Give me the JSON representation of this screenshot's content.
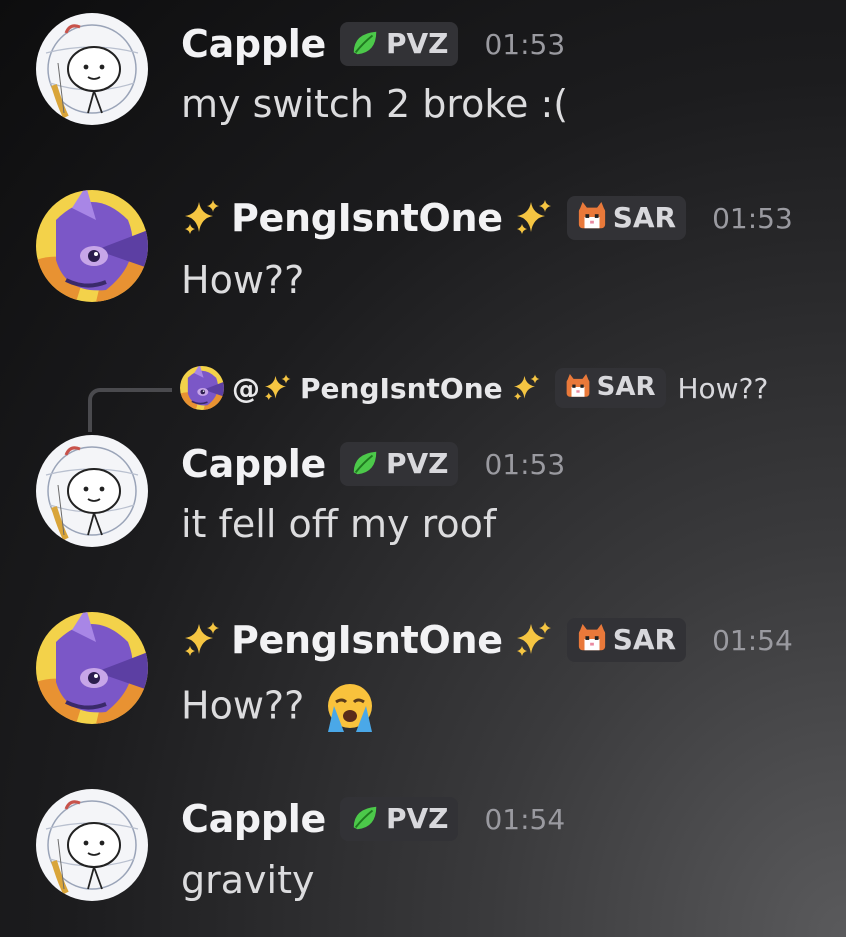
{
  "messages": [
    {
      "author": "Capple",
      "tag": "PVZ",
      "time": "01:53",
      "text": "my switch 2 broke :("
    },
    {
      "author": "PengIsntOne",
      "tag": "SAR",
      "time": "01:53",
      "text": "How??"
    },
    {
      "author": "Capple",
      "tag": "PVZ",
      "time": "01:53",
      "text": "it fell off my roof",
      "reply": {
        "mention": "@",
        "author": "PengIsntOne",
        "tag": "SAR",
        "text": "How??"
      }
    },
    {
      "author": "PengIsntOne",
      "tag": "SAR",
      "time": "01:54",
      "text": "How??"
    },
    {
      "author": "Capple",
      "tag": "PVZ",
      "time": "01:54",
      "text": "gravity"
    }
  ],
  "icons": {
    "sparkles": "sparkles-icon",
    "leaf": "leaf-icon",
    "cat": "cat-icon",
    "cry": "loudly-crying-face-emoji"
  },
  "colors": {
    "pvz_leaf": "#4cc94a",
    "sar_cat": "#e9793a",
    "sparkle": "#f5c542"
  }
}
